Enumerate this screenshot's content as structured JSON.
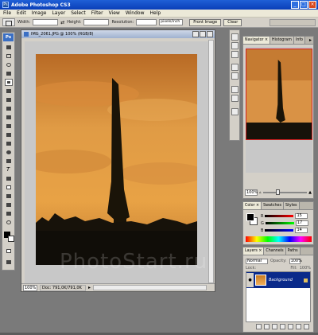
{
  "app": {
    "title": "Adobe Photoshop CS3",
    "logo_text": "Ps",
    "window_buttons": [
      "_",
      "□",
      "×"
    ]
  },
  "menu": [
    "File",
    "Edit",
    "Image",
    "Layer",
    "Select",
    "Filter",
    "View",
    "Window",
    "Help"
  ],
  "options_bar": {
    "width_label": "Width:",
    "swap_icon": "⇄",
    "height_label": "Height:",
    "resolution_label": "Resolution:",
    "resolution_unit": "pixels/inch",
    "front_image_label": "Front Image",
    "clear_label": "Clear"
  },
  "toolbox": {
    "badge": "Ps"
  },
  "document": {
    "title": "IMG_2061.JPG @ 100% (RGB/8)",
    "zoom": "100%",
    "doc_info": "Doc: 791,0K/791,0K",
    "watermark": "PhotoStart.ru"
  },
  "panels": {
    "navigator": {
      "tabs": [
        "Navigator ×",
        "Histogram",
        "Info"
      ],
      "zoom": "100%",
      "menu_icon": "▸"
    },
    "color": {
      "tabs": [
        "Color ×",
        "Swatches",
        "Styles"
      ],
      "channels": [
        {
          "label": "R",
          "value": "15"
        },
        {
          "label": "G",
          "value": "17"
        },
        {
          "label": "B",
          "value": "14"
        }
      ]
    },
    "layers": {
      "tabs": [
        "Layers ×",
        "Channels",
        "Paths"
      ],
      "blend_mode": "Normal",
      "opacity_label": "Opacity:",
      "opacity": "100%",
      "lock_label": "Lock:",
      "fill_label": "Fill:",
      "fill": "100%",
      "layer_name": "Background",
      "eye_icon": "●"
    }
  },
  "colors": {
    "accent": "#0a2a8a",
    "sky_top": "#c0702a",
    "sky_bottom": "#e8a040"
  }
}
